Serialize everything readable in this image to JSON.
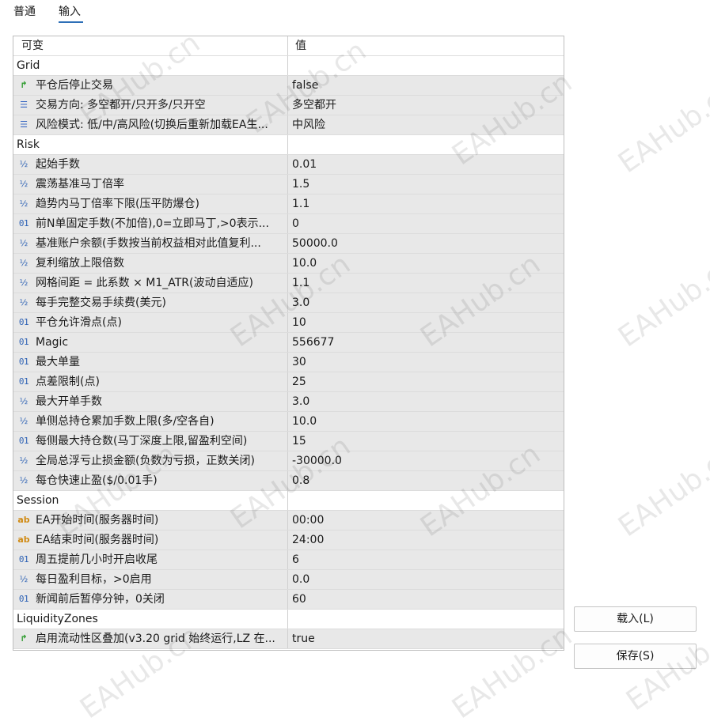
{
  "tabs": [
    {
      "label": "普通"
    },
    {
      "label": "输入"
    }
  ],
  "table": {
    "header": {
      "variable": "可变",
      "value": "值"
    },
    "rows": [
      {
        "type": "section",
        "label": "Grid",
        "value": ""
      },
      {
        "type": "param",
        "icon": "bool-arrow-icon",
        "label": "平仓后停止交易",
        "value": "false"
      },
      {
        "type": "param",
        "icon": "enum-list-icon",
        "label": "交易方向: 多空都开/只开多/只开空",
        "value": "多空都开"
      },
      {
        "type": "param",
        "icon": "enum-list-icon",
        "label": "风险模式: 低/中/高风险(切换后重新加载EA生...",
        "value": "中风险"
      },
      {
        "type": "section",
        "label": "Risk",
        "value": ""
      },
      {
        "type": "param",
        "icon": "double-icon",
        "label": "起始手数",
        "value": "0.01"
      },
      {
        "type": "param",
        "icon": "double-icon",
        "label": "震荡基准马丁倍率",
        "value": "1.5"
      },
      {
        "type": "param",
        "icon": "double-icon",
        "label": "趋势内马丁倍率下限(压平防爆仓)",
        "value": "1.1"
      },
      {
        "type": "param",
        "icon": "int-icon",
        "label": "前N单固定手数(不加倍),0=立即马丁,>0表示...",
        "value": "0"
      },
      {
        "type": "param",
        "icon": "double-icon",
        "label": "基准账户余额(手数按当前权益相对此值复利...",
        "value": "50000.0"
      },
      {
        "type": "param",
        "icon": "double-icon",
        "label": "复利缩放上限倍数",
        "value": "10.0"
      },
      {
        "type": "param",
        "icon": "double-icon",
        "label": "网格间距 = 此系数 × M1_ATR(波动自适应)",
        "value": "1.1"
      },
      {
        "type": "param",
        "icon": "double-icon",
        "label": "每手完整交易手续费(美元)",
        "value": "3.0"
      },
      {
        "type": "param",
        "icon": "int-icon",
        "label": "平仓允许滑点(点)",
        "value": "10"
      },
      {
        "type": "param",
        "icon": "int-icon",
        "label": "Magic",
        "value": "556677"
      },
      {
        "type": "param",
        "icon": "int-icon",
        "label": "最大单量",
        "value": "30"
      },
      {
        "type": "param",
        "icon": "int-icon",
        "label": "点差限制(点)",
        "value": "25"
      },
      {
        "type": "param",
        "icon": "double-icon",
        "label": "最大开单手数",
        "value": "3.0"
      },
      {
        "type": "param",
        "icon": "double-icon",
        "label": "单侧总持仓累加手数上限(多/空各自)",
        "value": "10.0"
      },
      {
        "type": "param",
        "icon": "int-icon",
        "label": "每侧最大持仓数(马丁深度上限,留盈利空间)",
        "value": "15"
      },
      {
        "type": "param",
        "icon": "double-icon",
        "label": "全局总浮亏止损金额(负数为亏损，正数关闭)",
        "value": "-30000.0"
      },
      {
        "type": "param",
        "icon": "double-icon",
        "label": "每仓快速止盈($/0.01手)",
        "value": "0.8"
      },
      {
        "type": "section",
        "label": "Session",
        "value": ""
      },
      {
        "type": "param",
        "icon": "string-icon",
        "label": "EA开始时间(服务器时间)",
        "value": "00:00"
      },
      {
        "type": "param",
        "icon": "string-icon",
        "label": "EA结束时间(服务器时间)",
        "value": "24:00"
      },
      {
        "type": "param",
        "icon": "int-icon",
        "label": "周五提前几小时开启收尾",
        "value": "6"
      },
      {
        "type": "param",
        "icon": "double-icon",
        "label": "每日盈利目标，>0启用",
        "value": "0.0"
      },
      {
        "type": "param",
        "icon": "int-icon",
        "label": "新闻前后暂停分钟，0关闭",
        "value": "60"
      },
      {
        "type": "section",
        "label": "LiquidityZones",
        "value": ""
      },
      {
        "type": "param",
        "icon": "bool-arrow-icon",
        "label": "启用流动性区叠加(v3.20 grid 始终运行,LZ 在...",
        "value": "true"
      }
    ]
  },
  "icon_glyphs": {
    "bool-arrow-icon": "↱",
    "enum-list-icon": "☰",
    "double-icon": "½",
    "int-icon": "01",
    "string-icon": "ab"
  },
  "buttons": {
    "load": "载入(L)",
    "save": "保存(S)"
  },
  "watermark": "EAHub.cn"
}
